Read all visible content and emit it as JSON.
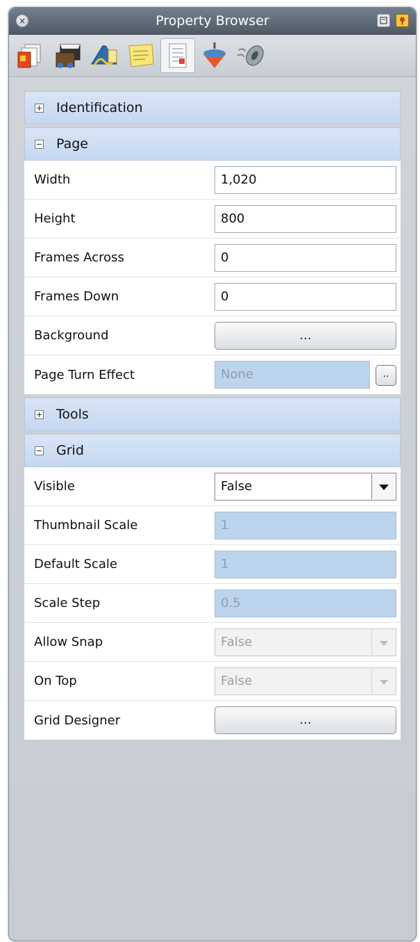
{
  "window": {
    "title": "Property Browser",
    "close_glyph": "×"
  },
  "toolbar": {
    "tools": [
      {
        "icon": "pages-icon"
      },
      {
        "icon": "media-icon"
      },
      {
        "icon": "text-signature-icon"
      },
      {
        "icon": "sticky-note-icon"
      },
      {
        "icon": "document-properties-icon",
        "active": true
      },
      {
        "icon": "spinning-top-icon"
      },
      {
        "icon": "mouse-icon"
      }
    ]
  },
  "groups": {
    "identification": {
      "label": "Identification",
      "expanded": false
    },
    "page": {
      "label": "Page",
      "expanded": true,
      "width": {
        "label": "Width",
        "value": "1,020"
      },
      "height": {
        "label": "Height",
        "value": "800"
      },
      "frames_across": {
        "label": "Frames Across",
        "value": "0"
      },
      "frames_down": {
        "label": "Frames Down",
        "value": "0"
      },
      "background": {
        "label": "Background",
        "button": "..."
      },
      "page_turn": {
        "label": "Page Turn Effect",
        "value": "None",
        "button": ".."
      }
    },
    "tools": {
      "label": "Tools",
      "expanded": false
    },
    "grid": {
      "label": "Grid",
      "expanded": true,
      "visible": {
        "label": "Visible",
        "value": "False"
      },
      "thumbnail_scale": {
        "label": "Thumbnail Scale",
        "value": "1"
      },
      "default_scale": {
        "label": "Default Scale",
        "value": "1"
      },
      "scale_step": {
        "label": "Scale Step",
        "value": "0.5"
      },
      "allow_snap": {
        "label": "Allow Snap",
        "value": "False"
      },
      "on_top": {
        "label": "On Top",
        "value": "False"
      },
      "grid_designer": {
        "label": "Grid Designer",
        "button": "..."
      }
    }
  },
  "colors": {
    "titlebar": "#5e6a77",
    "group_header": "#cddcf3",
    "disabled_field": "#bcd4ec"
  }
}
